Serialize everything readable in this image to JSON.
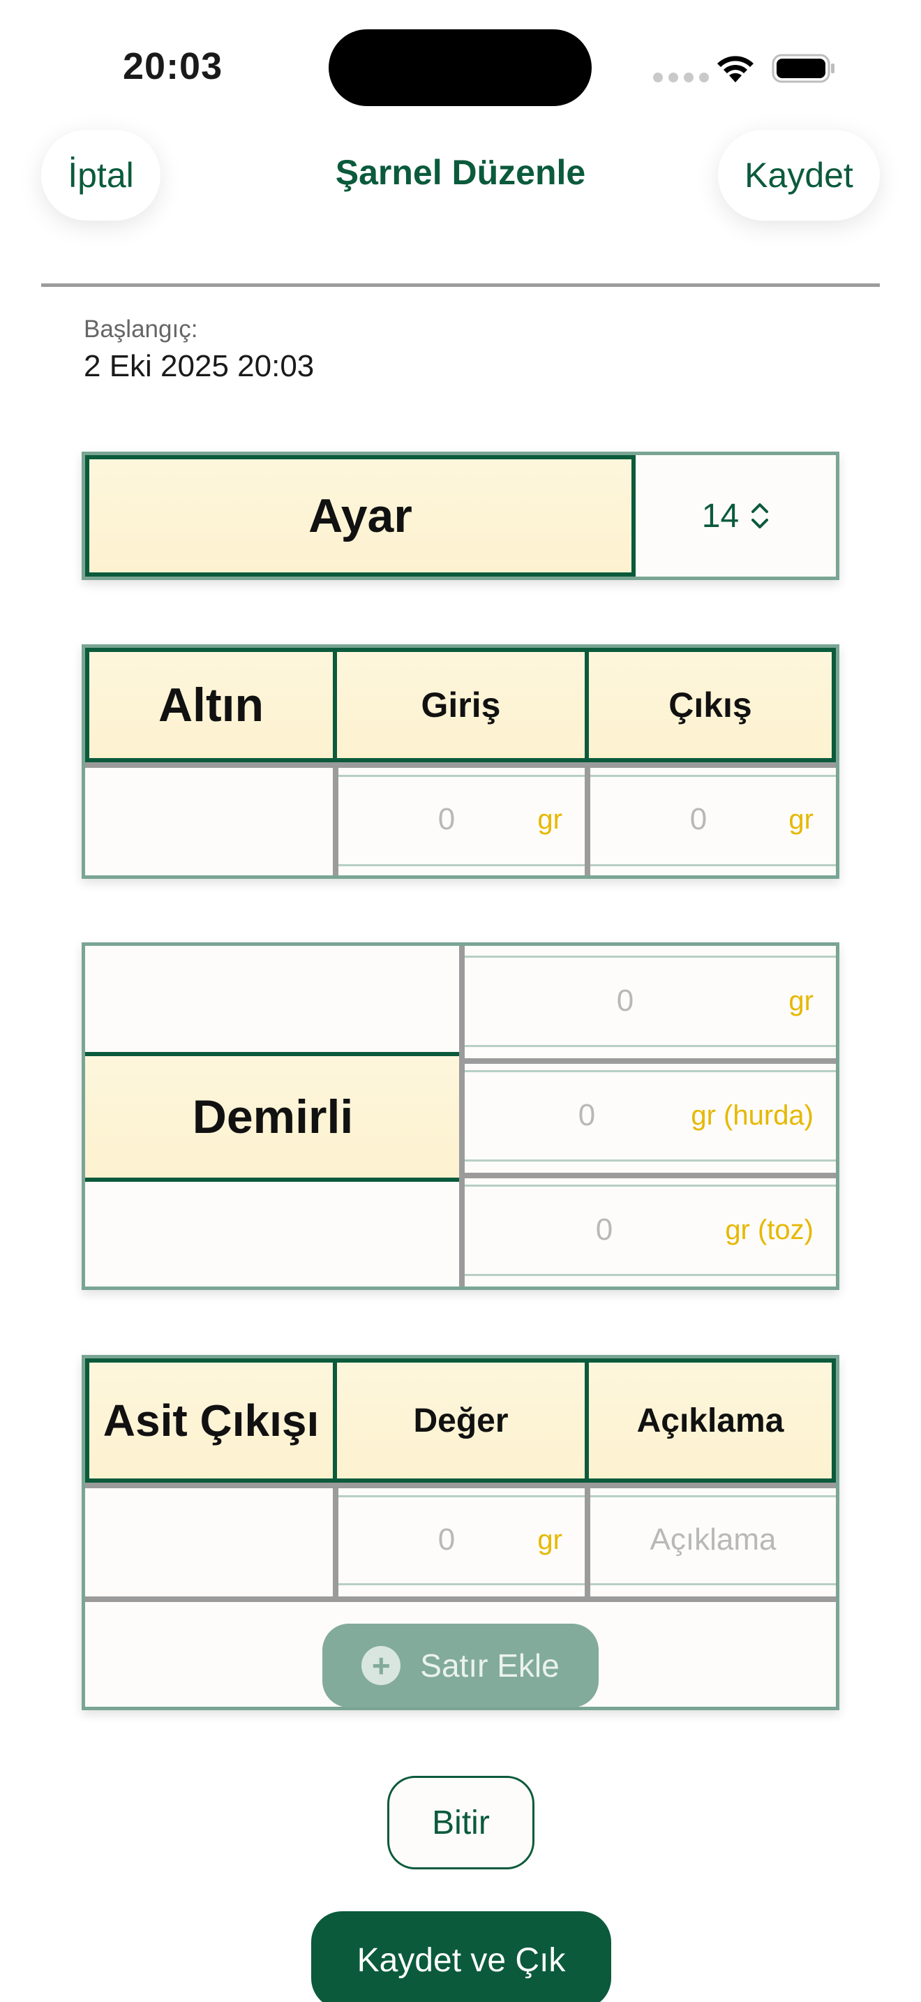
{
  "status_bar": {
    "time": "20:03"
  },
  "nav": {
    "cancel_label": "İptal",
    "title": "Şarnel Düzenle",
    "save_label": "Kaydet"
  },
  "start": {
    "label": "Başlangıç:",
    "value": "2 Eki 2025 20:03"
  },
  "ayar": {
    "label": "Ayar",
    "value": "14"
  },
  "altin": {
    "label": "Altın",
    "col_in": "Giriş",
    "col_out": "Çıkış",
    "in_value": "0",
    "in_unit": "gr",
    "out_value": "0",
    "out_unit": "gr"
  },
  "demirli": {
    "label": "Demirli",
    "rows": [
      {
        "value": "0",
        "unit": "gr"
      },
      {
        "value": "0",
        "unit": "gr (hurda)"
      },
      {
        "value": "0",
        "unit": "gr (toz)"
      }
    ]
  },
  "asit": {
    "label": "Asit Çıkışı",
    "col_value": "Değer",
    "col_desc": "Açıklama",
    "row_value": "0",
    "row_unit": "gr",
    "desc_placeholder": "Açıklama",
    "add_row_label": "Satır Ekle"
  },
  "actions": {
    "finish_label": "Bitir",
    "save_exit_label": "Kaydet ve Çık"
  },
  "colors": {
    "primary": "#0b5a3c",
    "accent_unit": "#e6b800",
    "header_cream": "#fdf4d6"
  }
}
